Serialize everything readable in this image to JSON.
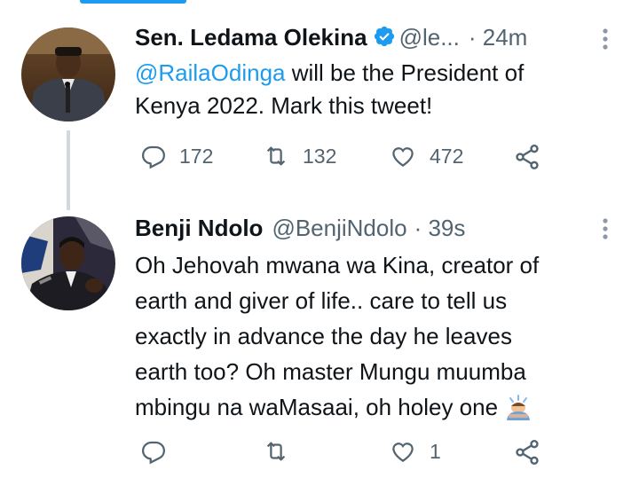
{
  "tweets": [
    {
      "author_name": "Sen. Ledama Olekina",
      "handle": "@le...",
      "time": "· 24m",
      "verified": true,
      "mention": "@RailaOdinga",
      "text_line1_rest": " will be the President of",
      "text_line2": "Kenya 2022. Mark this tweet!",
      "reply_count": "172",
      "retweet_count": "132",
      "like_count": "472"
    },
    {
      "author_name": "Benji Ndolo",
      "handle": "@BenjiNdolo",
      "time": "· 39s",
      "text_lines": [
        "Oh Jehovah mwana wa Kina, creator of",
        "earth and giver of life.. care to tell us",
        "exactly in advance the day he leaves",
        "earth too? Oh master Mungu muumba",
        "mbingu na waMasaai, oh holey one"
      ],
      "reply_count": "",
      "retweet_count": "",
      "like_count": "1"
    }
  ],
  "colors": {
    "accent": "#1d9bf0",
    "text": "#0f1419",
    "secondary": "#536471",
    "thread_line": "#cfd9de"
  },
  "icons": [
    "reply-icon",
    "retweet-icon",
    "like-icon",
    "share-icon",
    "more-icon",
    "verified-badge-icon"
  ]
}
